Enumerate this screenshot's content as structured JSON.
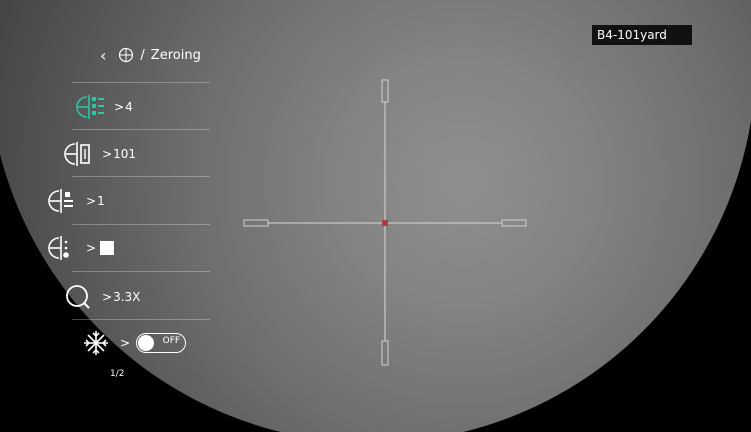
{
  "scope": {
    "badge": "B4-101yard"
  },
  "menu": {
    "header": {
      "back_icon": "chevron-left-icon",
      "crosshair_icon": "crosshair-icon",
      "separator": "/",
      "title": "Zeroing"
    },
    "items": [
      {
        "icon": "reticle-list-icon",
        "arrow": ">",
        "value": "4",
        "accent": "#2ec4a6"
      },
      {
        "icon": "reticle-distance-icon",
        "arrow": ">",
        "value": "101"
      },
      {
        "icon": "reticle-style-icon",
        "arrow": ">",
        "value": "1"
      },
      {
        "icon": "reticle-color-icon",
        "arrow": ">",
        "value": ""
      },
      {
        "icon": "zoom-icon",
        "arrow": ">",
        "value": "3.3X"
      },
      {
        "icon": "freeze-icon",
        "arrow": ">",
        "toggle_label": "OFF",
        "toggle_on": false
      }
    ],
    "pagination": "1/2"
  },
  "colors": {
    "accent": "#2ec4a6",
    "reticle_line": "#e0e0e0",
    "reticle_center": "#a84040"
  }
}
